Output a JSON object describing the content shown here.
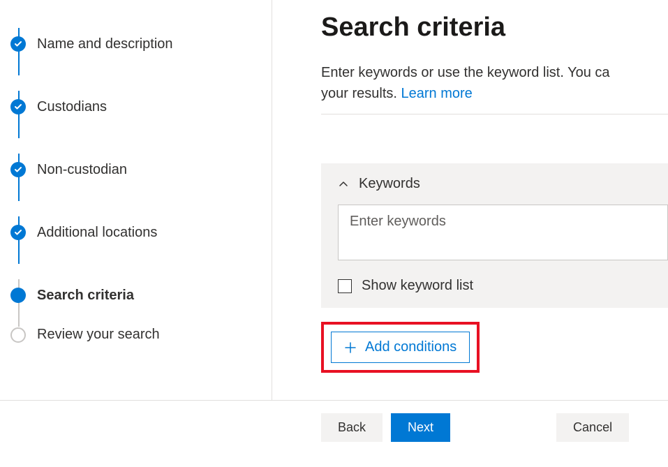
{
  "sidebar": {
    "steps": [
      {
        "label": "Name and description",
        "state": "done"
      },
      {
        "label": "Custodians",
        "state": "done"
      },
      {
        "label": "Non-custodian",
        "state": "done"
      },
      {
        "label": "Additional locations",
        "state": "done"
      },
      {
        "label": "Search criteria",
        "state": "current"
      },
      {
        "label": "Review your search",
        "state": "pending"
      }
    ]
  },
  "main": {
    "title": "Search criteria",
    "description_prefix": "Enter keywords or use the keyword list. You ca",
    "description_suffix": "your results. ",
    "learn_more": "Learn more",
    "keywords_section": {
      "title": "Keywords",
      "placeholder": "Enter keywords",
      "value": "",
      "show_list_label": "Show keyword list",
      "show_list_checked": false
    },
    "add_conditions_label": "Add conditions"
  },
  "footer": {
    "back": "Back",
    "next": "Next",
    "cancel": "Cancel"
  }
}
